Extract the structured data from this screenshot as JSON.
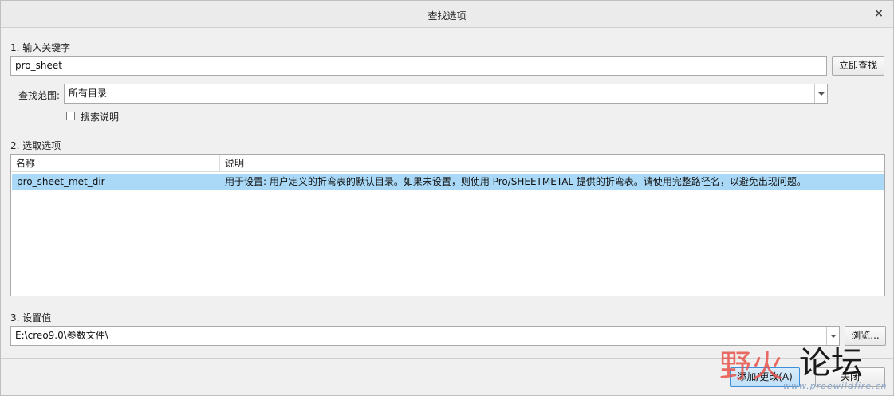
{
  "dialog": {
    "title": "查找选项",
    "close_glyph": "×"
  },
  "step1": {
    "label": "1.  输入关键字",
    "keyword_value": "pro_sheet",
    "search_button": "立即查找",
    "scope_label": "查找范围:",
    "scope_value": "所有目录",
    "search_desc_label": "搜索说明",
    "search_desc_checked": false
  },
  "step2": {
    "label": "2.  选取选项",
    "columns": [
      "名称",
      "说明"
    ],
    "rows": [
      {
        "name": "pro_sheet_met_dir",
        "description": "用于设置: 用户定义的折弯表的默认目录。如果未设置，则使用 Pro/SHEETMETAL 提供的折弯表。请使用完整路径名，以避免出现问题。"
      }
    ]
  },
  "step3": {
    "label": "3.  设置值",
    "value": "E:\\creo9.0\\参数文件\\",
    "browse_button": "浏览..."
  },
  "footer": {
    "add_change_button": "添加/更改(A)",
    "close_button": "关闭"
  },
  "watermark": {
    "text_red": "野火",
    "text_dark": "论坛",
    "url": "www.proewildfire.cn"
  },
  "colors": {
    "selected_row": "#a9d9f7",
    "primary_button_border": "#3c8fd8"
  }
}
